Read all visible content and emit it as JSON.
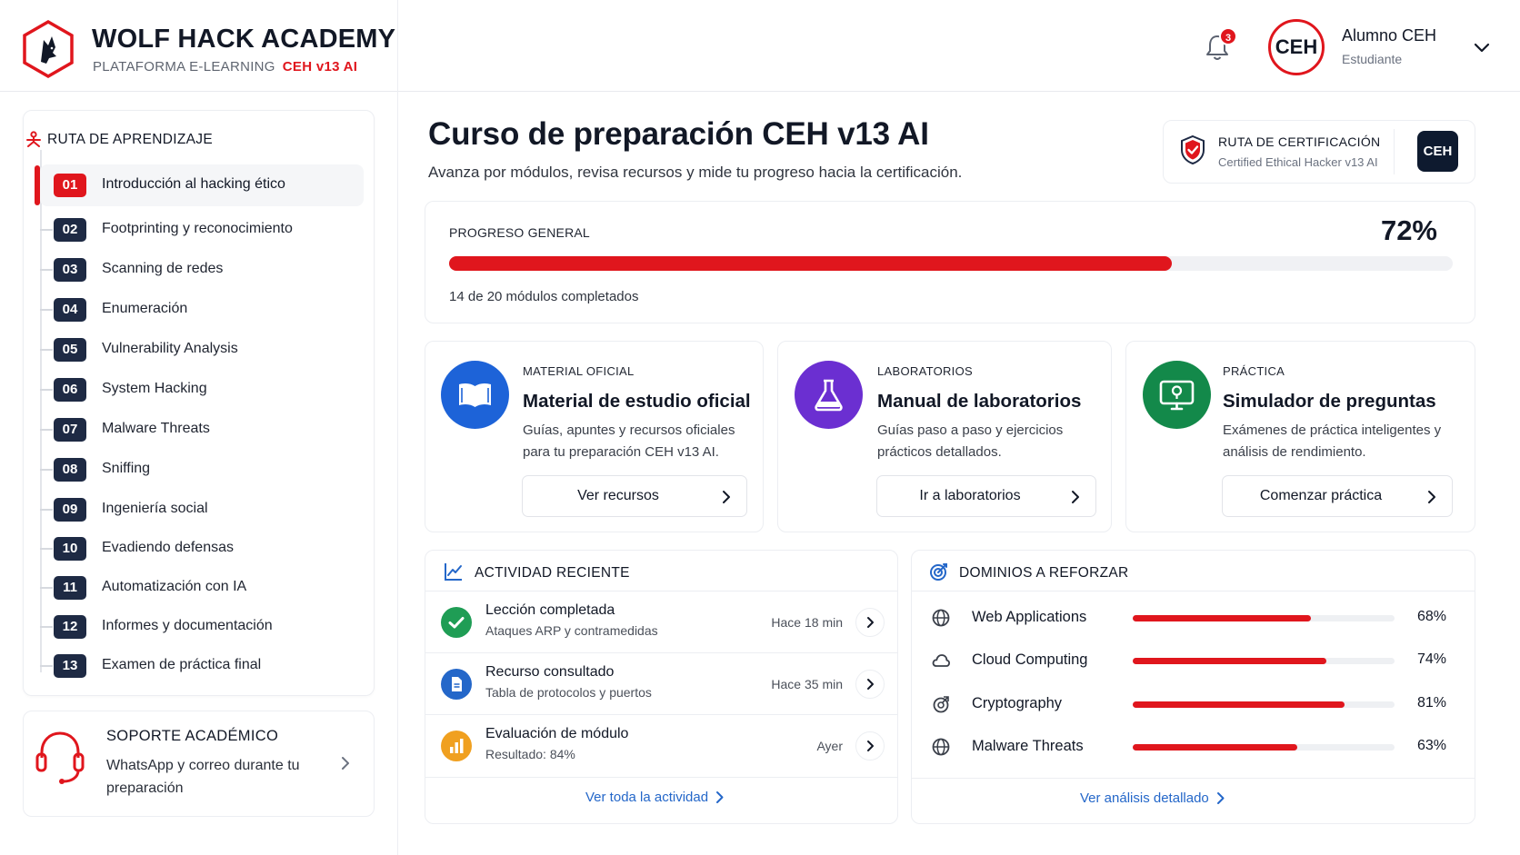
{
  "brand": {
    "title": "WOLF HACK ACADEMY",
    "subtitle": "PLATAFORMA E-LEARNING",
    "subtitle_accent": "CEH v13 AI"
  },
  "header": {
    "notifications_count": "3",
    "avatar_text": "CEH",
    "user_name": "Alumno CEH",
    "user_role": "Estudiante"
  },
  "sidebar": {
    "route_title": "RUTA DE APRENDIZAJE",
    "modules": [
      {
        "num": "01",
        "label": "Introducción al hacking ético"
      },
      {
        "num": "02",
        "label": "Footprinting y reconocimiento"
      },
      {
        "num": "03",
        "label": "Scanning de redes"
      },
      {
        "num": "04",
        "label": "Enumeración"
      },
      {
        "num": "05",
        "label": "Vulnerability Analysis"
      },
      {
        "num": "06",
        "label": "System Hacking"
      },
      {
        "num": "07",
        "label": "Malware Threats"
      },
      {
        "num": "08",
        "label": "Sniffing"
      },
      {
        "num": "09",
        "label": "Ingeniería social"
      },
      {
        "num": "10",
        "label": "Evadiendo defensas"
      },
      {
        "num": "11",
        "label": "Automatización con IA"
      },
      {
        "num": "12",
        "label": "Informes y documentación"
      },
      {
        "num": "13",
        "label": "Examen de práctica final"
      }
    ],
    "support": {
      "title": "SOPORTE ACADÉMICO",
      "text": "WhatsApp y correo durante tu preparación"
    }
  },
  "main": {
    "title": "Curso de preparación CEH v13 AI",
    "subtitle": "Avanza por módulos, revisa recursos y mide tu progreso hacia la certificación.",
    "certification": {
      "title": "RUTA DE CERTIFICACIÓN",
      "subtitle": "Certified Ethical Hacker v13 AI",
      "badge": "CEH"
    },
    "progress": {
      "label": "PROGRESO GENERAL",
      "value_text": "72%",
      "fraction": 0.72,
      "note": "14 de 20 módulos completados"
    },
    "resources": [
      {
        "kicker": "MATERIAL OFICIAL",
        "title": "Material de estudio oficial",
        "desc": "Guías, apuntes y recursos oficiales para tu preparación CEH v13 AI.",
        "button": "Ver recursos",
        "icon": "book-icon",
        "color": "#1d63d8"
      },
      {
        "kicker": "LABORATORIOS",
        "title": "Manual de laboratorios",
        "desc": "Guías paso a paso y ejercicios prácticos detallados.",
        "button": "Ir a laboratorios",
        "icon": "flask-icon",
        "color": "#6b2fd1"
      },
      {
        "kicker": "PRÁCTICA",
        "title": "Simulador de preguntas",
        "desc": "Exámenes de práctica inteligentes y análisis de rendimiento.",
        "button": "Comenzar práctica",
        "icon": "monitor-icon",
        "color": "#13894a"
      }
    ],
    "activity": {
      "title": "ACTIVIDAD RECIENTE",
      "items": [
        {
          "title": "Lección completada",
          "sub": "Ataques ARP y contramedidas",
          "time": "Hace 18 min",
          "icon": "check-icon",
          "color": "#1f9d55"
        },
        {
          "title": "Recurso consultado",
          "sub": "Tabla de protocolos y puertos",
          "time": "Hace 35 min",
          "icon": "document-icon",
          "color": "#2467c9"
        },
        {
          "title": "Evaluación de módulo",
          "sub": "Resultado: 84%",
          "time": "Ayer",
          "icon": "bar-chart-icon",
          "color": "#f0a020"
        }
      ],
      "link": "Ver toda la actividad"
    },
    "domains": {
      "title": "DOMINIOS A REFORZAR",
      "items": [
        {
          "name": "Web Applications",
          "pct_text": "68%",
          "value": 0.68,
          "icon": "globe-icon"
        },
        {
          "name": "Cloud Computing",
          "pct_text": "74%",
          "value": 0.74,
          "icon": "cloud-icon"
        },
        {
          "name": "Cryptography",
          "pct_text": "81%",
          "value": 0.81,
          "icon": "crypto-icon"
        },
        {
          "name": "Malware Threats",
          "pct_text": "63%",
          "value": 0.63,
          "icon": "globe-icon"
        }
      ],
      "link": "Ver análisis detallado"
    }
  },
  "colors": {
    "accent": "#e0161d",
    "navy": "#1e2a44",
    "link": "#2467c9"
  }
}
